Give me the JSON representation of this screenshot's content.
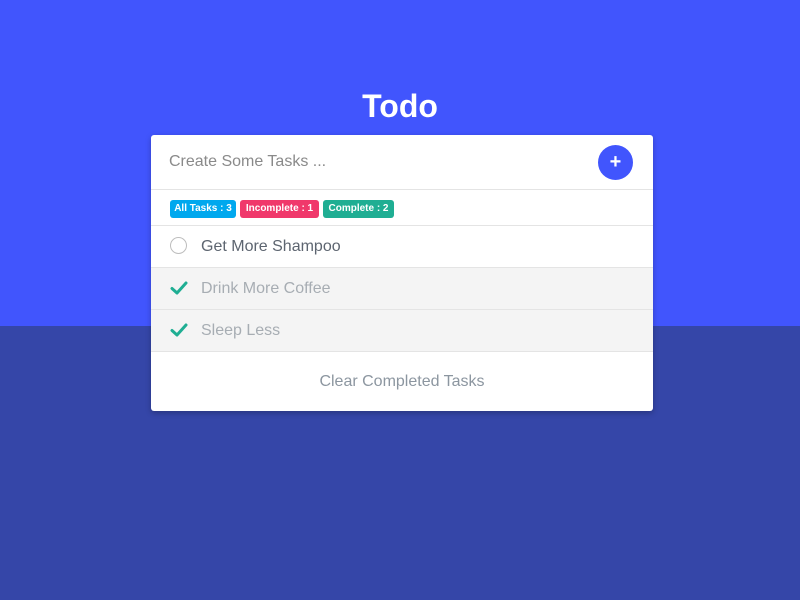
{
  "app": {
    "title": "Todo"
  },
  "colors": {
    "background_top": "#4155fd",
    "background_bottom": "#3546a8",
    "accent": "#4155fd",
    "all_badge": "#00a8ee",
    "incomplete_badge": "#f0386b",
    "complete_badge": "#1fae93",
    "check": "#1fae93"
  },
  "input": {
    "placeholder": "Create Some Tasks ...",
    "value": ""
  },
  "add_button": {
    "label": "+"
  },
  "filters": {
    "all": "All Tasks : 3",
    "incomplete": "Incomplete : 1",
    "complete": "Complete : 2"
  },
  "tasks": [
    {
      "label": "Get More Shampoo",
      "completed": false,
      "icon": "empty-circle-icon"
    },
    {
      "label": "Drink More Coffee",
      "completed": true,
      "icon": "checkmark-icon"
    },
    {
      "label": "Sleep Less",
      "completed": true,
      "icon": "checkmark-icon"
    }
  ],
  "footer": {
    "clear_label": "Clear Completed Tasks"
  }
}
